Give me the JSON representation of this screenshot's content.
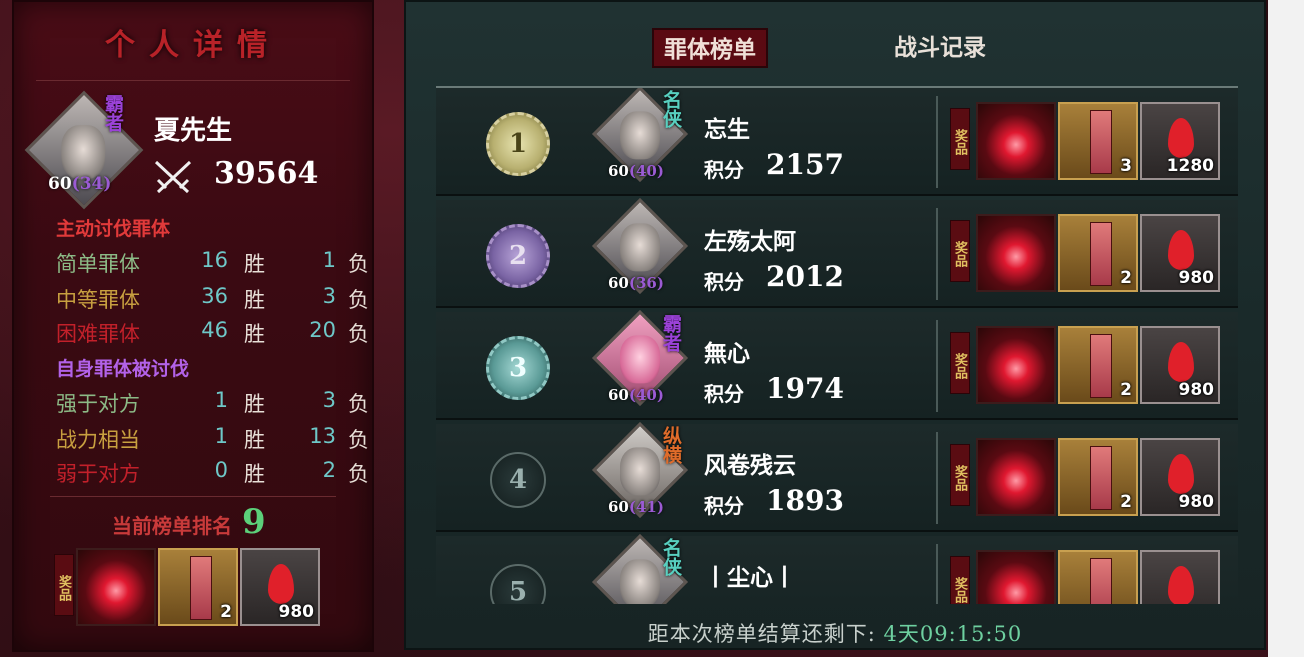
{
  "left": {
    "title": "个人详情",
    "player": {
      "name": "夏先生",
      "level": "60",
      "level_alt": "(34)",
      "tag": "霸者",
      "power": "39564"
    },
    "section_active": "主动讨伐罪体",
    "active_stats": [
      {
        "label": "简单罪体",
        "win": "16",
        "lose": "1"
      },
      {
        "label": "中等罪体",
        "win": "36",
        "lose": "3"
      },
      {
        "label": "困难罪体",
        "win": "46",
        "lose": "20"
      }
    ],
    "section_passive": "自身罪体被讨伐",
    "passive_stats": [
      {
        "label": "强于对方",
        "win": "1",
        "lose": "3"
      },
      {
        "label": "战力相当",
        "win": "1",
        "lose": "13"
      },
      {
        "label": "弱于对方",
        "win": "0",
        "lose": "2"
      }
    ],
    "win_label": "胜",
    "lose_label": "负",
    "rank_label": "当前榜单排名",
    "rank_value": "9",
    "reward_tag": "奖品",
    "rewards": {
      "scroll_qty": "2",
      "drop_qty": "980"
    }
  },
  "tabs": {
    "active": "罪体榜单",
    "inactive": "战斗记录"
  },
  "score_label": "积分",
  "reward_tag": "奖品",
  "rows": [
    {
      "rank": "1",
      "name": "忘生",
      "score": "2157",
      "level": "60",
      "level_alt": "(40)",
      "tag": "名侠",
      "scroll_qty": "3",
      "drop_qty": "1280"
    },
    {
      "rank": "2",
      "name": "左殇太阿",
      "score": "2012",
      "level": "60",
      "level_alt": "(36)",
      "tag": "",
      "scroll_qty": "2",
      "drop_qty": "980"
    },
    {
      "rank": "3",
      "name": "無心",
      "score": "1974",
      "level": "60",
      "level_alt": "(40)",
      "tag": "霸者",
      "scroll_qty": "2",
      "drop_qty": "980"
    },
    {
      "rank": "4",
      "name": "风卷残云",
      "score": "1893",
      "level": "60",
      "level_alt": "(41)",
      "tag": "纵横",
      "scroll_qty": "2",
      "drop_qty": "980"
    },
    {
      "rank": "5",
      "name": "丨尘心丨",
      "score": "",
      "level": "",
      "level_alt": "",
      "tag": "名侠",
      "scroll_qty": "",
      "drop_qty": ""
    }
  ],
  "footer": {
    "label": "距本次榜单结算还剩下:",
    "time": "4天09:15:50"
  },
  "colors": {
    "panel_left": "#4a0c16",
    "panel_right": "#1d2a2a",
    "tab_active": "#5a0a12",
    "rank_value": "#5cd07a"
  }
}
